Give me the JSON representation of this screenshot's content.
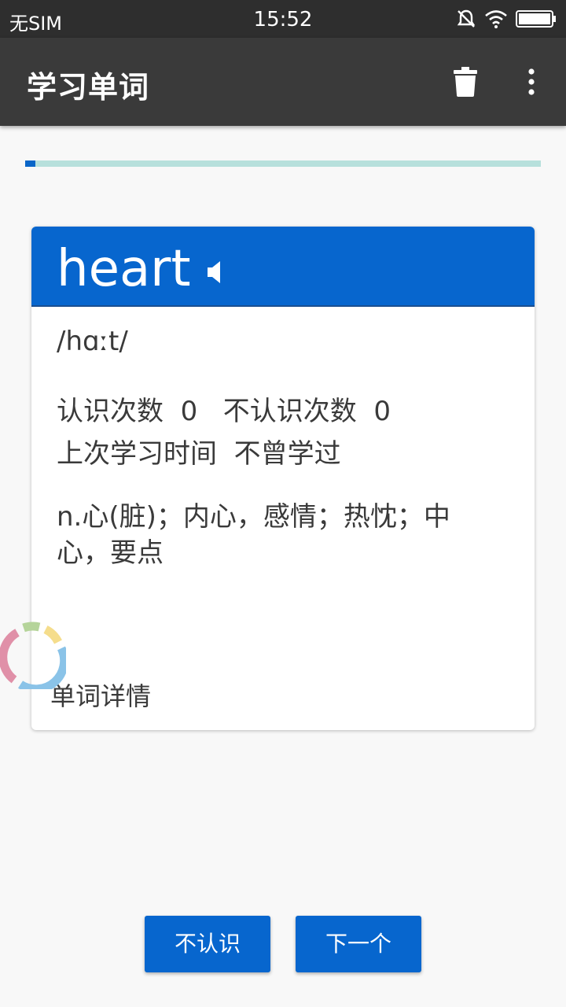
{
  "status_bar": {
    "carrier": "无SIM",
    "time": "15:52",
    "icons": [
      "muted-bell-icon",
      "wifi-icon",
      "battery-icon"
    ]
  },
  "app_bar": {
    "title": "学习单词",
    "actions": [
      "trash-icon",
      "more-vert-icon"
    ]
  },
  "progress": {
    "fraction": 0.02,
    "fill_color": "#0a66c8",
    "track_color": "#b7e0dc"
  },
  "card": {
    "word": "heart",
    "phonetic": "/hɑːt/",
    "known_label": "认识次数",
    "known_count": "0",
    "unknown_label": "不认识次数",
    "unknown_count": "0",
    "last_study_label": "上次学习时间",
    "last_study_value": "不曾学过",
    "meaning": "n.心(脏)；内心，感情；热忱；中心，要点",
    "detail_link": "单词详情"
  },
  "buttons": {
    "unknown": "不认识",
    "next": "下一个"
  },
  "colors": {
    "accent": "#0766ce",
    "app_bar": "#3a3a3a",
    "status_bar": "#2e2e2e"
  }
}
